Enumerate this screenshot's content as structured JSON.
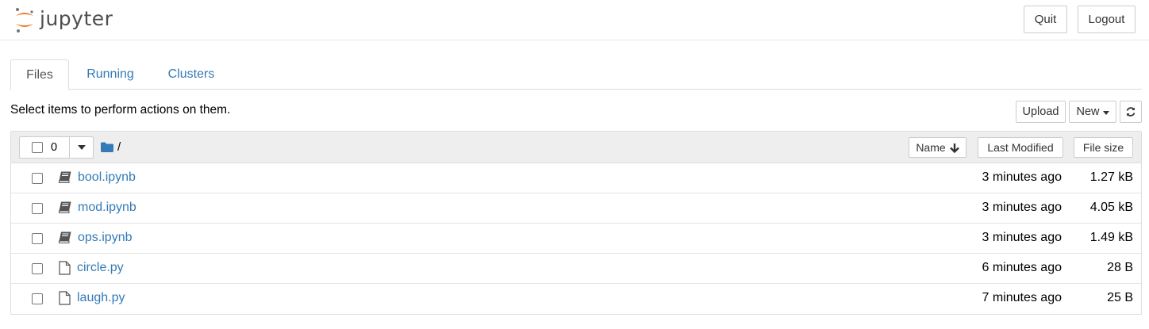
{
  "header": {
    "logo_text": "jupyter",
    "quit_label": "Quit",
    "logout_label": "Logout"
  },
  "tabs": [
    {
      "label": "Files",
      "active": true
    },
    {
      "label": "Running",
      "active": false
    },
    {
      "label": "Clusters",
      "active": false
    }
  ],
  "toolbar": {
    "hint": "Select items to perform actions on them.",
    "upload_label": "Upload",
    "new_label": "New"
  },
  "list_header": {
    "selected_count": "0",
    "path": "/",
    "sort_name_label": "Name",
    "sort_modified_label": "Last Modified",
    "sort_size_label": "File size"
  },
  "files": [
    {
      "name": "bool.ipynb",
      "type": "notebook",
      "modified": "3 minutes ago",
      "size": "1.27 kB"
    },
    {
      "name": "mod.ipynb",
      "type": "notebook",
      "modified": "3 minutes ago",
      "size": "4.05 kB"
    },
    {
      "name": "ops.ipynb",
      "type": "notebook",
      "modified": "3 minutes ago",
      "size": "1.49 kB"
    },
    {
      "name": "circle.py",
      "type": "file",
      "modified": "6 minutes ago",
      "size": "28 B"
    },
    {
      "name": "laugh.py",
      "type": "file",
      "modified": "7 minutes ago",
      "size": "25 B"
    }
  ],
  "colors": {
    "link": "#337ab7",
    "logo_orange": "#f37726",
    "header_bg": "#eeeeee"
  }
}
